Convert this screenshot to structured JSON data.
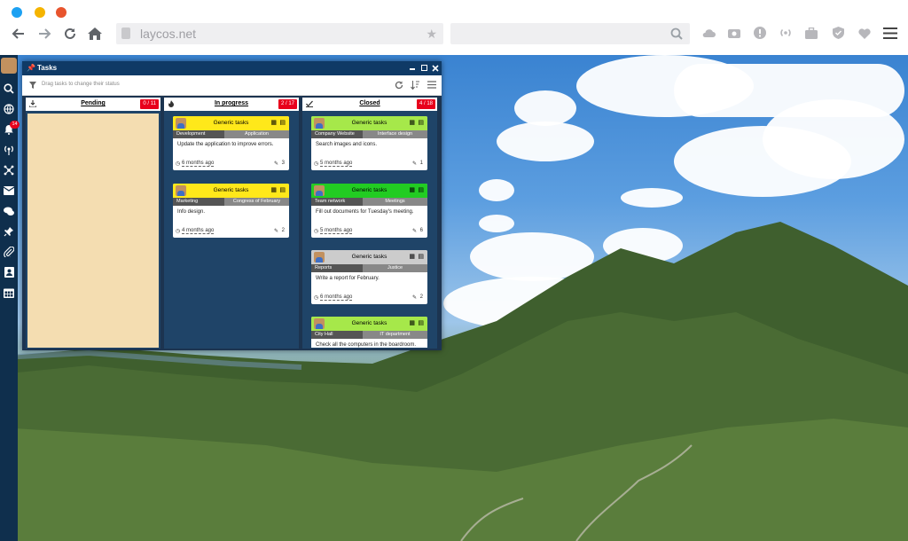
{
  "browser": {
    "url": "laycos.net",
    "dots": [
      "#1da1f2",
      "#f5b400",
      "#e8542d"
    ]
  },
  "sidebar": {
    "notification_count": "14"
  },
  "tasks_window": {
    "title": "Tasks",
    "toolbar_hint": "Drag tasks to change their status",
    "columns": [
      {
        "name": "Pending",
        "badge": "0 / 11",
        "cards": []
      },
      {
        "name": "In progress",
        "badge": "2 / 17",
        "cards": [
          {
            "title": "Generic tasks",
            "color": "#ffe81a",
            "tag1": "Development",
            "tag2": "Application",
            "desc": "Update the application to improve errors.",
            "time": "6 months ago",
            "count": "3"
          },
          {
            "title": "Generic tasks",
            "color": "#ffe81a",
            "tag1": "Marketing",
            "tag2": "Congress of February",
            "desc": "Info design.",
            "time": "4 months ago",
            "count": "2"
          }
        ]
      },
      {
        "name": "Closed",
        "badge": "4 / 18",
        "cards": [
          {
            "title": "Generic tasks",
            "color": "#a6e84a",
            "tag1": "Company Website",
            "tag2": "Interface design",
            "desc": "Search images and icons.",
            "time": "5 months ago",
            "count": "1"
          },
          {
            "title": "Generic tasks",
            "color": "#22cc22",
            "tag1": "Team network",
            "tag2": "Meetings",
            "desc": "Fill out documents for Tuesday's meeting.",
            "time": "5 months ago",
            "count": "6"
          },
          {
            "title": "Generic tasks",
            "color": "#cccccc",
            "tag1": "Reports",
            "tag2": "Justice",
            "desc": "Write a report for February.",
            "time": "6 months ago",
            "count": "2"
          },
          {
            "title": "Generic tasks",
            "color": "#a6e84a",
            "tag1": "City Hall",
            "tag2": "IT department",
            "desc": "Check all the computers in the boardroom.",
            "time": "",
            "count": ""
          }
        ]
      }
    ]
  }
}
